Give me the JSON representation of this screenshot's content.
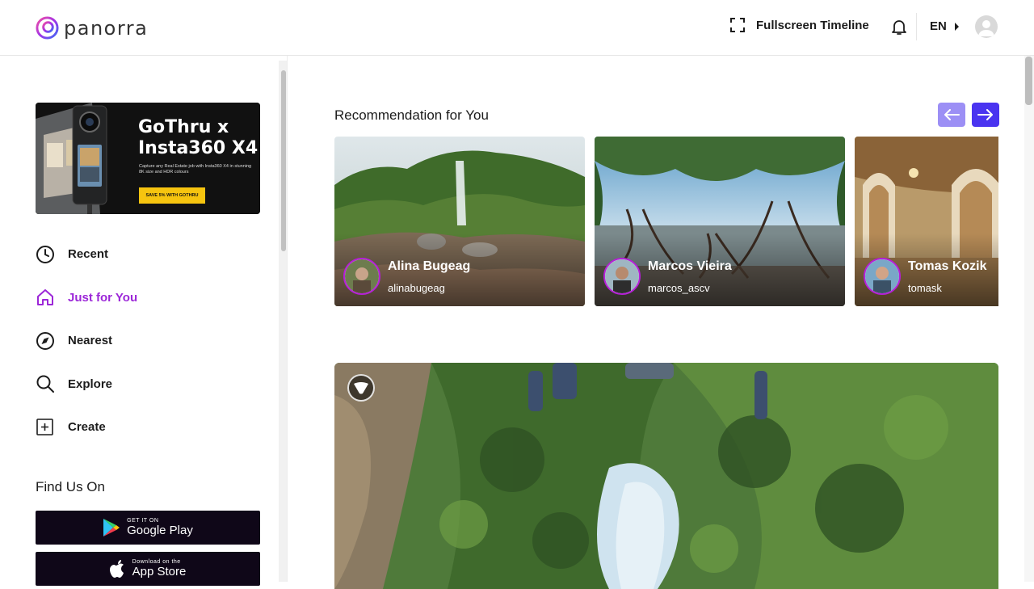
{
  "brand": {
    "name": "panorra",
    "accent": "#9c27d8"
  },
  "header": {
    "fullscreen_label": "Fullscreen Timeline",
    "fullscreen_icon": "fullscreen-icon",
    "bell_icon": "bell-icon",
    "language": "EN"
  },
  "banner": {
    "title_line1": "GoThru x",
    "title_line2": "Insta360 X4",
    "body": "Capture any Real Estate job with Insta360 X4 in stunning 8K size and HDR colours",
    "cta": "SAVE 5% WITH GOTHRU"
  },
  "nav": {
    "items": [
      {
        "label": "Recent",
        "icon": "clock-icon",
        "active": false
      },
      {
        "label": "Just for You",
        "icon": "home-icon",
        "active": true
      },
      {
        "label": "Nearest",
        "icon": "compass-icon",
        "active": false
      },
      {
        "label": "Explore",
        "icon": "search-icon",
        "active": false
      },
      {
        "label": "Create",
        "icon": "plus-square-icon",
        "active": false
      }
    ]
  },
  "find_us": {
    "title": "Find Us On",
    "google_play": {
      "small": "GET IT ON",
      "big": "Google Play"
    },
    "app_store": {
      "small": "Download on the",
      "big": "App Store"
    }
  },
  "recommendations": {
    "title": "Recommendation for You",
    "cards": [
      {
        "name": "Alina Bugeag",
        "handle": "alinabugeag"
      },
      {
        "name": "Marcos Vieira",
        "handle": "marcos_ascv"
      },
      {
        "name": "Tomas Kozik",
        "handle": "tomask"
      }
    ]
  },
  "colors": {
    "arrow_prev": "#9c8ff5",
    "arrow_next": "#4a34f0",
    "avatar_ring": "#b61fd8",
    "store_bg": "#0f0718"
  }
}
